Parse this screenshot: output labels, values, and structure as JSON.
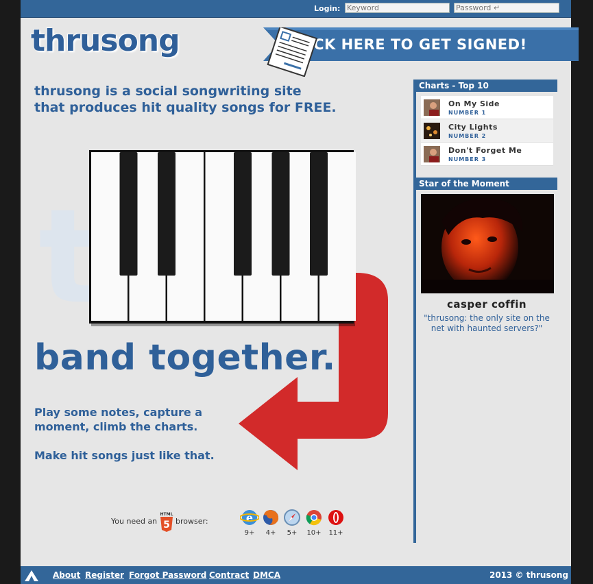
{
  "login": {
    "label": "Login:",
    "keyword_placeholder": "Keyword",
    "password_placeholder": "Password ↵"
  },
  "logo": {
    "text": "thrusong"
  },
  "banner": {
    "label": "CLICK HERE TO GET SIGNED!"
  },
  "tagline": {
    "line1": "thrusong is a social songwriting site",
    "line2": "that produces hit quality songs for FREE."
  },
  "headline": "band together.",
  "body": {
    "line1": "Play some notes, capture a",
    "line2": "moment, climb the charts.",
    "line3": "Make hit songs just like that."
  },
  "browsers": {
    "need_text": "You need an",
    "html5_label": "HTML",
    "html5_digit": "5",
    "browser_text": "browser:",
    "items": [
      {
        "name": "ie-icon",
        "version": "9+"
      },
      {
        "name": "firefox-icon",
        "version": "4+"
      },
      {
        "name": "safari-icon",
        "version": "5+"
      },
      {
        "name": "chrome-icon",
        "version": "10+"
      },
      {
        "name": "opera-icon",
        "version": "11+"
      }
    ]
  },
  "sidebar": {
    "charts_header": "Charts - Top 10",
    "charts": [
      {
        "title": "On My Side",
        "rank": "NUMBER 1"
      },
      {
        "title": "City Lights",
        "rank": "NUMBER 2"
      },
      {
        "title": "Don't Forget Me",
        "rank": "NUMBER 3"
      }
    ],
    "star_header": "Star of the Moment",
    "star_name": "casper coffin",
    "star_quote": "\"thrusong: the only site on the net with haunted servers?\""
  },
  "footer": {
    "links": [
      "About",
      "Register",
      "Forgot Password",
      "Contract",
      "DMCA"
    ],
    "copyright": "2013 © thrusong"
  },
  "colors": {
    "brand_blue": "#336699",
    "text_blue": "#2f6099",
    "arrow_red": "#d22a2a",
    "page_bg": "#e6e6e6"
  }
}
